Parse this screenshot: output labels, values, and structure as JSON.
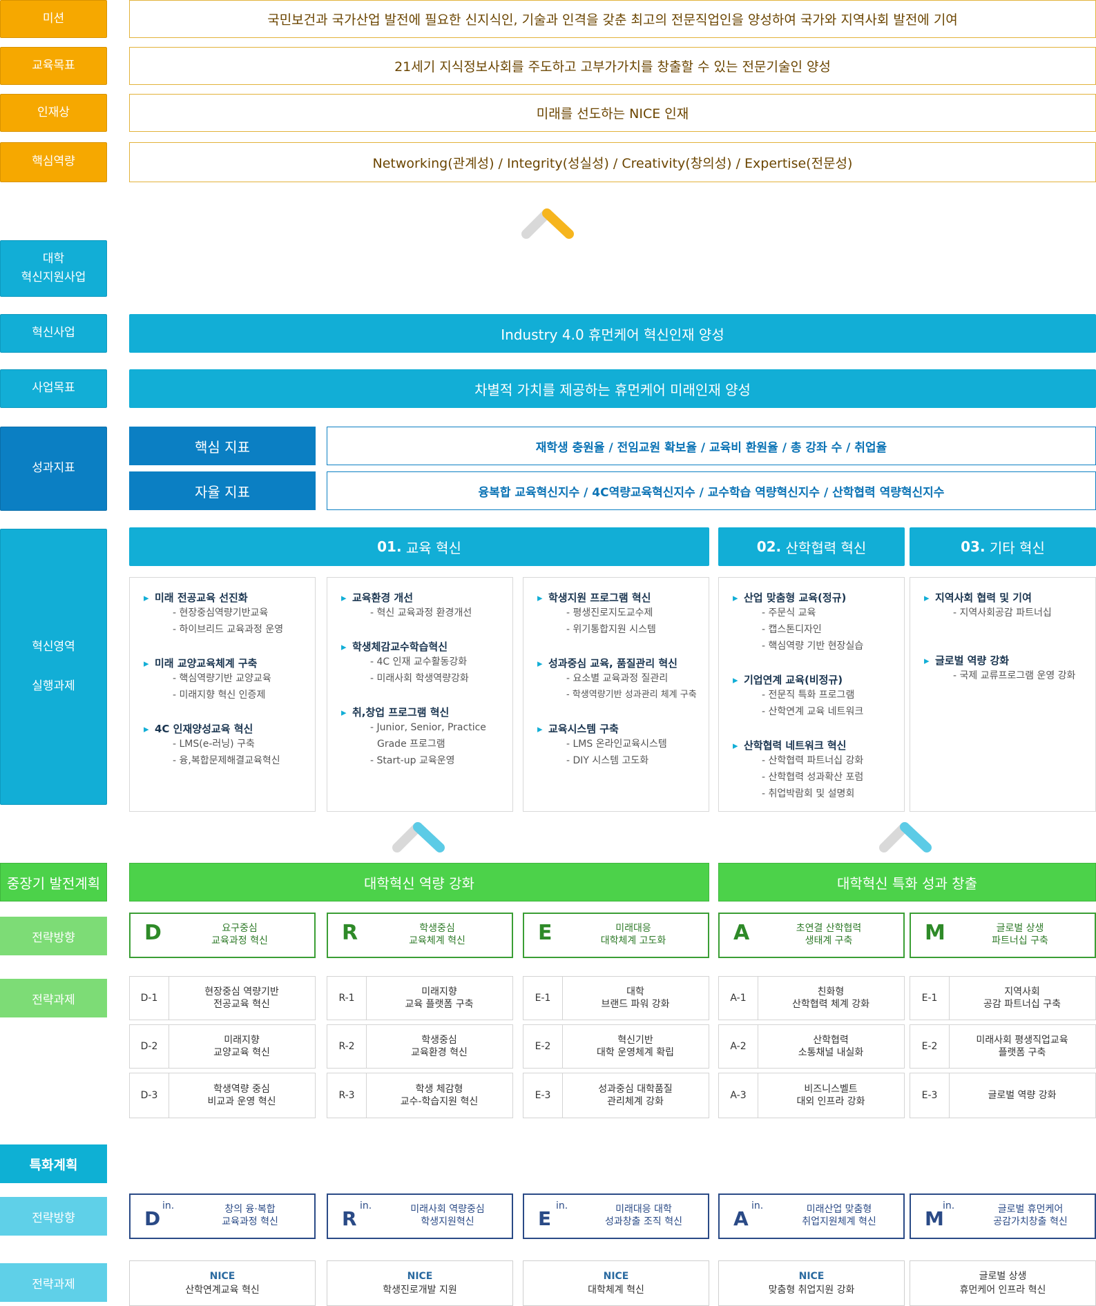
{
  "top": [
    {
      "label": "미션",
      "text": "국민보건과 국가산업 발전에 필요한 신지식인, 기술과 인격을 갖춘 최고의 전문직업인을 양성하여 국가와 지역사회 발전에 기여"
    },
    {
      "label": "교육목표",
      "text": "21세기 지식정보사회를 주도하고 고부가가치를 창출할 수 있는 전문기술인 양성"
    },
    {
      "label": "인재상",
      "text": "미래를 선도하는 NICE 인재"
    },
    {
      "label": "핵심역량",
      "text": "Networking(관계성) / Integrity(성실성) / Creativity(창의성) / Expertise(전문성)"
    }
  ],
  "innovation": {
    "section_label": "대학\n혁신지원사업",
    "project_label": "혁신사업",
    "project_text": "Industry 4.0 휴먼케어 혁신인재 양성",
    "goal_label": "사업목표",
    "goal_text": "차별적 가치를 제공하는 휴먼케어 미래인재 양성",
    "kpi_label": "성과지표",
    "kpi_core_label": "핵심 지표",
    "kpi_core_text": "재학생 충원율 / 전임교원 확보율 / 교육비 환원율 / 총 강좌 수 / 취업율",
    "kpi_auto_label": "자율 지표",
    "kpi_auto_text": "융복합 교육혁신지수 / 4C역량교육혁신지수 / 교수학습 역량혁신지수 / 산학협력 역량혁신지수",
    "area_label_1": "혁신영역",
    "area_label_2": "실행과제",
    "areas": [
      {
        "num": "01.",
        "name": "교육 혁신"
      },
      {
        "num": "02.",
        "name": "산학협력 혁신"
      },
      {
        "num": "03.",
        "name": "기타 혁신"
      }
    ],
    "panels": [
      [
        {
          "title": "미래 전공교육 선진화",
          "items": [
            "- 현장중심역량기반교육",
            "- 하이브리드 교육과정 운영"
          ]
        },
        {
          "title": "미래 교양교육체계 구축",
          "items": [
            "- 핵심역량기반 교양교육",
            "- 미래지향 혁신 인증제"
          ]
        },
        {
          "title": "4C 인재양성교육 혁신",
          "items": [
            "- LMS(e-러닝) 구축",
            "- 융,복합문제해결교육혁신"
          ]
        }
      ],
      [
        {
          "title": "교육환경 개선",
          "items": [
            "- 혁신 교육과정 환경개선"
          ]
        },
        {
          "title": "학생체감교수학습혁신",
          "items": [
            "- 4C 인재 교수활동강화",
            "- 미래사회 학생역량강화"
          ]
        },
        {
          "title": "취,창업 프로그램 혁신",
          "items": [
            "- Junior, Senior, Practice",
            "Grade 프로그램",
            "- Start-up 교육운영"
          ]
        }
      ],
      [
        {
          "title": "학생지원 프로그램 혁신",
          "items": [
            "- 평생진로지도교수제",
            "- 위기통합지원 시스템"
          ]
        },
        {
          "title": "성과중심 교육, 품질관리 혁신",
          "items": [
            "- 요소별  교육과정 질관리",
            "- 학생역량기반 성과관리 체계 구축"
          ]
        },
        {
          "title": "교육시스템 구축",
          "items": [
            "- LMS 온라인교육시스템",
            "- DIY 시스템 고도화"
          ]
        }
      ],
      [
        {
          "title": "산업 맞춤형 교육(정규)",
          "items": [
            "- 주문식 교육",
            "- 캡스톤디자인",
            "- 핵심역량 기반 현장실습"
          ]
        },
        {
          "title": "기업연계 교육(비정규)",
          "items": [
            "- 전문직 특화 프로그램",
            "- 산학연계 교육 네트워크"
          ]
        },
        {
          "title": "산학협력 네트워크 혁신",
          "items": [
            "- 산학협력 파트너십 강화",
            "- 산학협력 성과확산 포럼",
            "- 취업박람회 및 설명회"
          ]
        }
      ],
      [
        {
          "title": "지역사회 협력 및 기여",
          "items": [
            "- 지역사회공감 파트너십"
          ]
        },
        {
          "title": "글로벌 역량 강화",
          "items": [
            "- 국제 교류프로그램 운영 강화"
          ]
        }
      ]
    ]
  },
  "midterm": {
    "label": "중장기 발전계획",
    "bar1": "대학혁신 역량 강화",
    "bar2": "대학혁신 특화 성과 창출",
    "dir_label": "전략방향",
    "directions": [
      {
        "letter": "D",
        "text": "요구중심\n교육과정 혁신"
      },
      {
        "letter": "R",
        "text": "학생중심\n교육체계 혁신"
      },
      {
        "letter": "E",
        "text": "미래대응\n대학체계 고도화"
      },
      {
        "letter": "A",
        "text": "초연결 산학협력\n생태계 구축"
      },
      {
        "letter": "M",
        "text": "글로벌 상생\n파트너십 구축"
      }
    ],
    "task_label": "전략과제",
    "tasks": [
      [
        {
          "code": "D-1",
          "text": "현장중심 역량기반\n전공교육 혁신"
        },
        {
          "code": "D-2",
          "text": "미래지향\n교양교육 혁신"
        },
        {
          "code": "D-3",
          "text": "학생역량 중심\n비교과 운영 혁신"
        }
      ],
      [
        {
          "code": "R-1",
          "text": "미래지향\n교육 플랫폼 구축"
        },
        {
          "code": "R-2",
          "text": "학생중심\n교육환경 혁신"
        },
        {
          "code": "R-3",
          "text": "학생 체감형\n교수-학습지원 혁신"
        }
      ],
      [
        {
          "code": "E-1",
          "text": "대학\n브랜드 파워 강화"
        },
        {
          "code": "E-2",
          "text": "혁신기반\n대학 운영체계 확립"
        },
        {
          "code": "E-3",
          "text": "성과중심 대학품질\n관리체계 강화"
        }
      ],
      [
        {
          "code": "A-1",
          "text": "친화형\n산학협력 체계 강화"
        },
        {
          "code": "A-2",
          "text": "산학협력\n소통채널 내실화"
        },
        {
          "code": "A-3",
          "text": "비즈니스벨트\n대외 인프라 강화"
        }
      ],
      [
        {
          "code": "E-1",
          "text": "지역사회\n공감 파트너십 구축"
        },
        {
          "code": "E-2",
          "text": "미래사회 평생직업교육\n플랫폼 구축"
        },
        {
          "code": "E-3",
          "text": "글로벌 역량 강화"
        }
      ]
    ]
  },
  "special": {
    "label": "특화계획",
    "dir_label": "전략방향",
    "directions": [
      {
        "letter": "D",
        "sup": "in.",
        "text": "창의 융·복합\n교육과정 혁신"
      },
      {
        "letter": "R",
        "sup": "in.",
        "text": "미래사회 역량중심\n학생지원혁신"
      },
      {
        "letter": "E",
        "sup": "in.",
        "text": "미래대응 대학\n성과창출 조직 혁신"
      },
      {
        "letter": "A",
        "sup": "in.",
        "text": "미래산업 맞춤형\n취업지원체계 혁신"
      },
      {
        "letter": "M",
        "sup": "in.",
        "text": "글로벌 휴먼케어\n공감가치창출 혁신"
      }
    ],
    "task_label": "전략과제",
    "tasks": [
      {
        "n": "NICE",
        "text": "산학연계교육 혁신"
      },
      {
        "n": "NICE",
        "text": "학생진로개발 지원"
      },
      {
        "n": "NICE",
        "text": "대학체계 혁신"
      },
      {
        "n": "NICE",
        "text": "맞춤형 취업지원 강화"
      },
      {
        "n": "",
        "text": "글로벌 상생\n휴먼케어 인프라 혁신"
      }
    ]
  },
  "colors": {
    "orange": "#f6a800",
    "teal": "#12aed6",
    "blue": "#0b7fc3",
    "green": "#4cd24a",
    "light_green": "#7ddc76",
    "navy": "#2a4a86"
  }
}
